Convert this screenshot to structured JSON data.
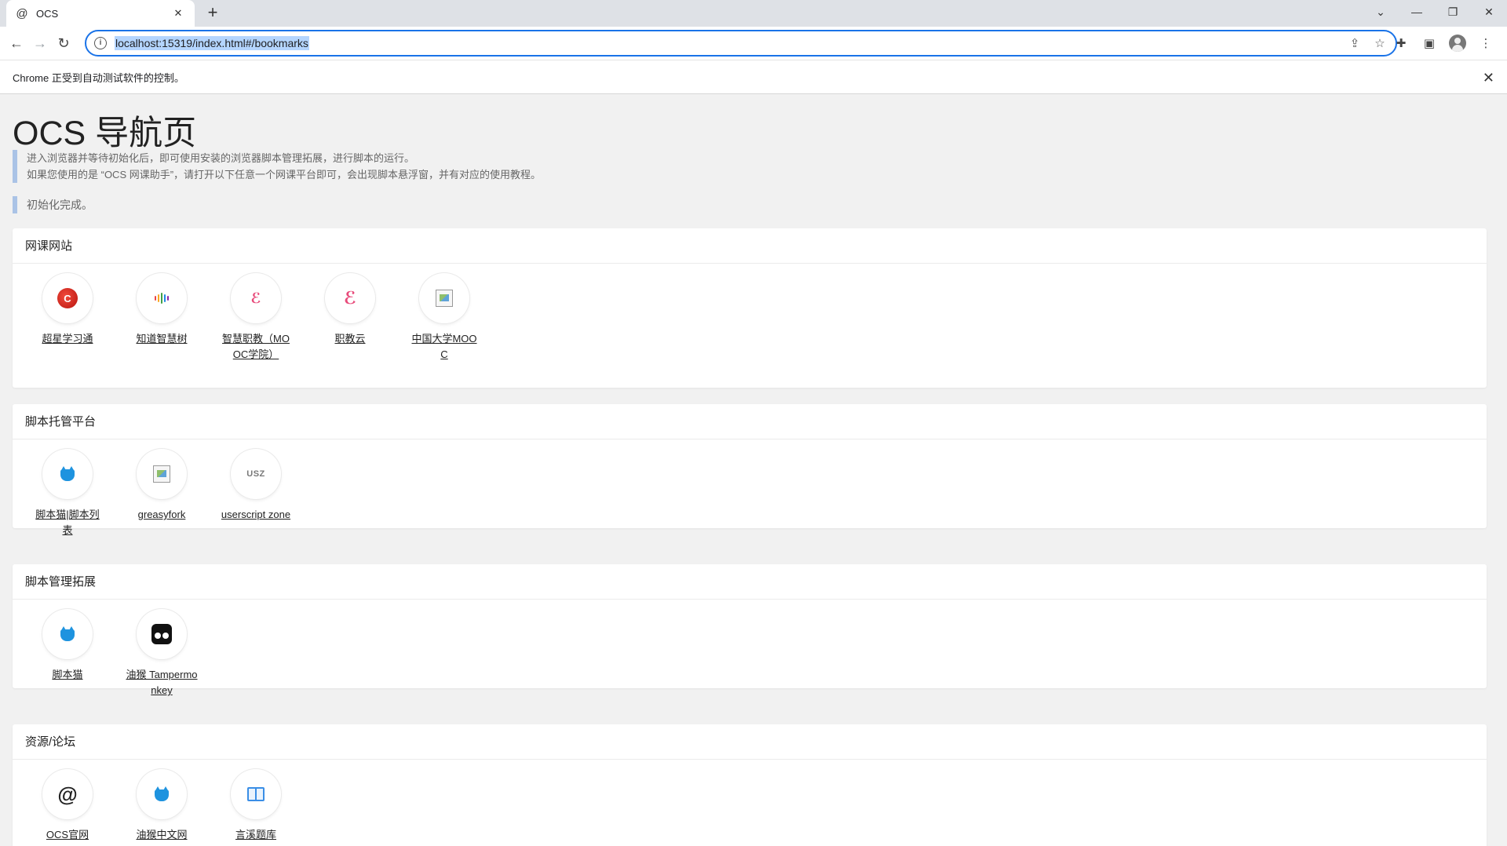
{
  "browser": {
    "tab_title": "OCS",
    "tab_favicon": "at-icon",
    "new_tab_label": "+",
    "url": "localhost:15319/index.html#/bookmarks",
    "infobar_text": "Chrome 正受到自动测试软件的控制。"
  },
  "page": {
    "title": "OCS 导航页",
    "notice_line1": "进入浏览器并等待初始化后，即可使用安装的浏览器脚本管理拓展，进行脚本的运行。",
    "notice_line2": "如果您使用的是 “OCS 网课助手”，请打开以下任意一个网课平台即可，会出现脚本悬浮窗，并有对应的使用教程。",
    "status": "初始化完成。"
  },
  "sections": [
    {
      "title": "网课网站",
      "items": [
        {
          "label": "超星学习通",
          "icon": "chaoxing-icon"
        },
        {
          "label": "知道智慧树",
          "icon": "zhihuishu-icon"
        },
        {
          "label": "智慧职教（MOOC学院）",
          "icon": "icve-icon"
        },
        {
          "label": "职教云",
          "icon": "zjy-icon"
        },
        {
          "label": "中国大学MOOC",
          "icon": "broken-image-icon"
        }
      ]
    },
    {
      "title": "脚本托管平台",
      "items": [
        {
          "label": "脚本猫|脚本列表",
          "icon": "scriptcat-icon"
        },
        {
          "label": "greasyfork",
          "icon": "broken-image-icon"
        },
        {
          "label": "userscript zone",
          "icon": "usz-icon",
          "icon_text": "USZ"
        }
      ]
    },
    {
      "title": "脚本管理拓展",
      "items": [
        {
          "label": "脚本猫",
          "icon": "scriptcat-icon"
        },
        {
          "label": "油猴 Tampermonkey",
          "icon": "tampermonkey-icon"
        }
      ]
    },
    {
      "title": "资源/论坛",
      "items": [
        {
          "label": "OCS官网",
          "icon": "at-icon"
        },
        {
          "label": "油猴中文网",
          "icon": "scriptcat-icon"
        },
        {
          "label": "言溪题库",
          "icon": "book-icon"
        }
      ]
    }
  ],
  "colors": {
    "accent": "#1a73e8",
    "notice_border": "#aac3e6",
    "page_bg": "#f1f1f1"
  }
}
